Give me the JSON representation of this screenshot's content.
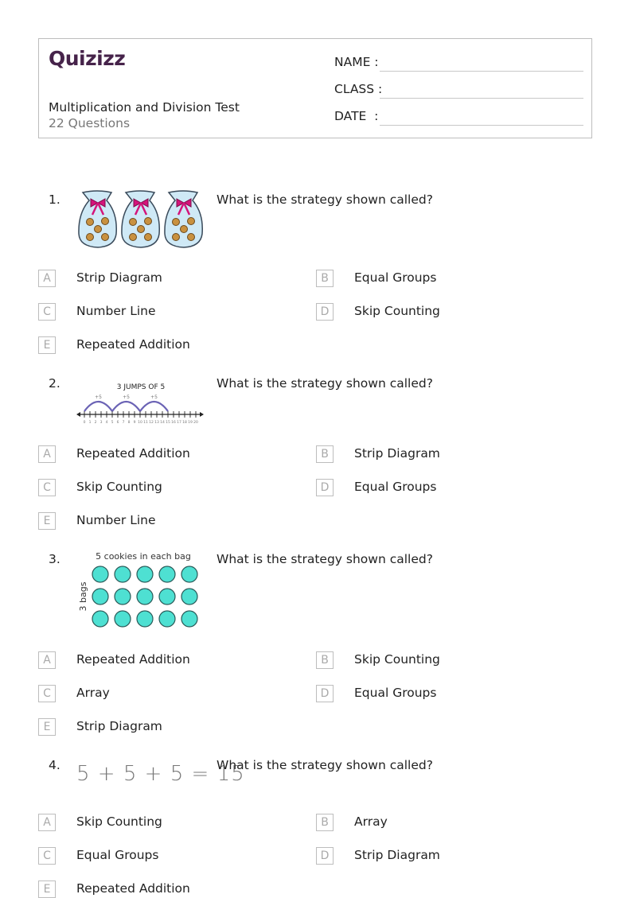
{
  "header": {
    "logo": "Quizizz",
    "title": "Multiplication and Division Test",
    "question_count": "22 Questions",
    "fields": [
      {
        "label": "NAME :"
      },
      {
        "label": "CLASS :"
      },
      {
        "label": "DATE  :"
      }
    ]
  },
  "questions": [
    {
      "number": "1.",
      "text": "What is the strategy shown called?",
      "image": "three-cookie-bags",
      "options": [
        {
          "letter": "A",
          "label": "Strip Diagram"
        },
        {
          "letter": "B",
          "label": "Equal Groups"
        },
        {
          "letter": "C",
          "label": "Number Line"
        },
        {
          "letter": "D",
          "label": "Skip Counting"
        },
        {
          "letter": "E",
          "label": "Repeated Addition"
        }
      ]
    },
    {
      "number": "2.",
      "text": "What is the strategy shown called?",
      "image": "number-line-jumps",
      "image_title": "3 JUMPS OF 5",
      "image_jumps": [
        "+5",
        "+5",
        "+5"
      ],
      "image_ticks": [
        "0",
        "1",
        "2",
        "3",
        "4",
        "5",
        "6",
        "7",
        "8",
        "9",
        "10",
        "11",
        "12",
        "13",
        "14",
        "15",
        "16",
        "17",
        "18",
        "19",
        "20"
      ],
      "options": [
        {
          "letter": "A",
          "label": "Repeated Addition"
        },
        {
          "letter": "B",
          "label": "Strip Diagram"
        },
        {
          "letter": "C",
          "label": "Skip Counting"
        },
        {
          "letter": "D",
          "label": "Equal Groups"
        },
        {
          "letter": "E",
          "label": "Number Line"
        }
      ]
    },
    {
      "number": "3.",
      "text": "What is the strategy shown called?",
      "image": "cookie-array",
      "image_top_label": "5 cookies in each bag",
      "image_side_label": "3 bags",
      "options": [
        {
          "letter": "A",
          "label": "Repeated Addition"
        },
        {
          "letter": "B",
          "label": "Skip Counting"
        },
        {
          "letter": "C",
          "label": "Array"
        },
        {
          "letter": "D",
          "label": "Equal Groups"
        },
        {
          "letter": "E",
          "label": "Strip Diagram"
        }
      ]
    },
    {
      "number": "4.",
      "text": "What is the strategy shown called?",
      "image": "addition-equation",
      "image_equation": "5 + 5 + 5 = 15",
      "options": [
        {
          "letter": "A",
          "label": "Skip Counting"
        },
        {
          "letter": "B",
          "label": "Array"
        },
        {
          "letter": "C",
          "label": "Equal Groups"
        },
        {
          "letter": "D",
          "label": "Strip Diagram"
        },
        {
          "letter": "E",
          "label": "Repeated Addition"
        }
      ]
    }
  ]
}
